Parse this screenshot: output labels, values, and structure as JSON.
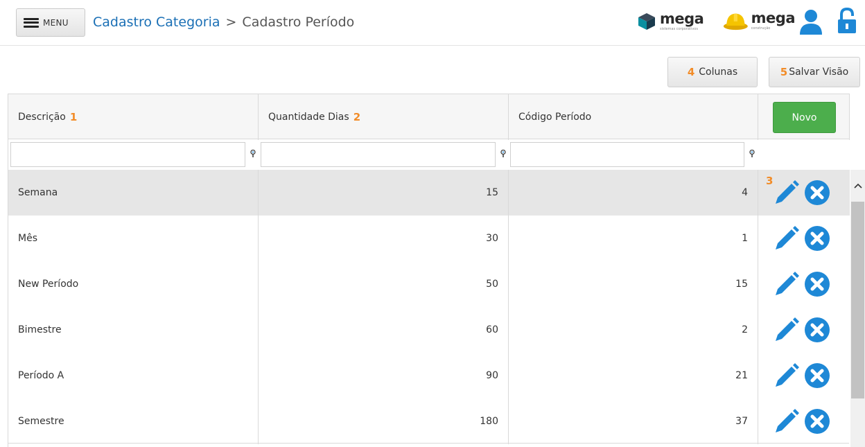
{
  "header": {
    "menu_label": "MENU",
    "breadcrumb_parent": "Cadastro Categoria",
    "breadcrumb_separator": ">",
    "breadcrumb_current": "Cadastro Período",
    "logo1_text": "mega",
    "logo1_sub": "sistemas corporativos",
    "logo2_text": "mega",
    "logo2_sub": "construção"
  },
  "toolbar": {
    "colunas_badge": "4",
    "colunas_label": "Colunas",
    "salvar_badge": "5",
    "salvar_label": "Salvar Visão"
  },
  "grid": {
    "columns": [
      {
        "label": "Descrição",
        "badge": "1"
      },
      {
        "label": "Quantidade Dias",
        "badge": "2"
      },
      {
        "label": "Código Período",
        "badge": ""
      }
    ],
    "novo_label": "Novo",
    "action_badge": "3",
    "filters": [
      "",
      "",
      ""
    ],
    "rows": [
      {
        "descricao": "Semana",
        "quantidade_dias": "15",
        "codigo_periodo": "4",
        "selected": true
      },
      {
        "descricao": "Mês",
        "quantidade_dias": "30",
        "codigo_periodo": "1",
        "selected": false
      },
      {
        "descricao": "New Período",
        "quantidade_dias": "50",
        "codigo_periodo": "15",
        "selected": false
      },
      {
        "descricao": "Bimestre",
        "quantidade_dias": "60",
        "codigo_periodo": "2",
        "selected": false
      },
      {
        "descricao": "Período A",
        "quantidade_dias": "90",
        "codigo_periodo": "21",
        "selected": false
      },
      {
        "descricao": "Semestre",
        "quantidade_dias": "180",
        "codigo_periodo": "37",
        "selected": false
      }
    ]
  },
  "colors": {
    "link": "#1a6fb5",
    "badge": "#f28c28",
    "novo_button": "#4cae4c",
    "action_icon": "#1e88d6",
    "selected_row": "#e6e6e6"
  },
  "icons": [
    "hamburger-icon",
    "mega-logo",
    "mega-construcao-logo",
    "user-icon",
    "lock-icon",
    "filter-icon",
    "edit-icon",
    "delete-icon",
    "scroll-up-icon"
  ]
}
